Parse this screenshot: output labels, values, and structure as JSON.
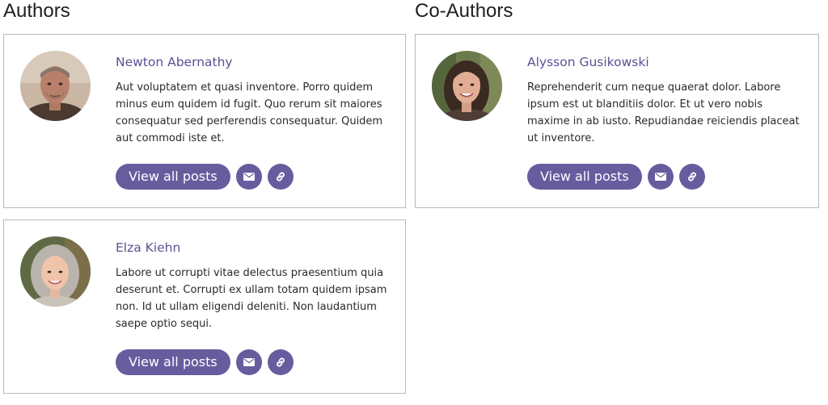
{
  "sections": {
    "authors_title": "Authors",
    "coauthors_title": "Co-Authors"
  },
  "authors": [
    {
      "name": "Newton Abernathy",
      "bio": "Aut voluptatem et quasi inventore. Porro quidem minus eum quidem id fugit. Quo rerum sit maiores consequatur sed perferendis consequatur. Quidem aut commodi iste et.",
      "view_label": "View all posts",
      "email_icon": "envelope-icon",
      "link_icon": "link-icon"
    },
    {
      "name": "Elza Kiehn",
      "bio": "Labore ut corrupti vitae delectus praesentium quia deserunt et. Corrupti ex ullam totam quidem ipsam non. Id ut ullam eligendi deleniti. Non laudantium saepe optio sequi.",
      "view_label": "View all posts",
      "email_icon": "envelope-icon",
      "link_icon": "link-icon"
    }
  ],
  "coauthors": [
    {
      "name": "Alysson Gusikowski",
      "bio": "Reprehenderit cum neque quaerat dolor. Labore ipsum est ut blanditiis dolor. Et ut vero nobis maxime in ab iusto. Repudiandae reiciendis placeat ut inventore.",
      "view_label": "View all posts",
      "email_icon": "envelope-icon",
      "link_icon": "link-icon"
    }
  ],
  "colors": {
    "accent": "#665c9e",
    "name_link": "#5b5193",
    "card_border": "#b9b9b9"
  }
}
